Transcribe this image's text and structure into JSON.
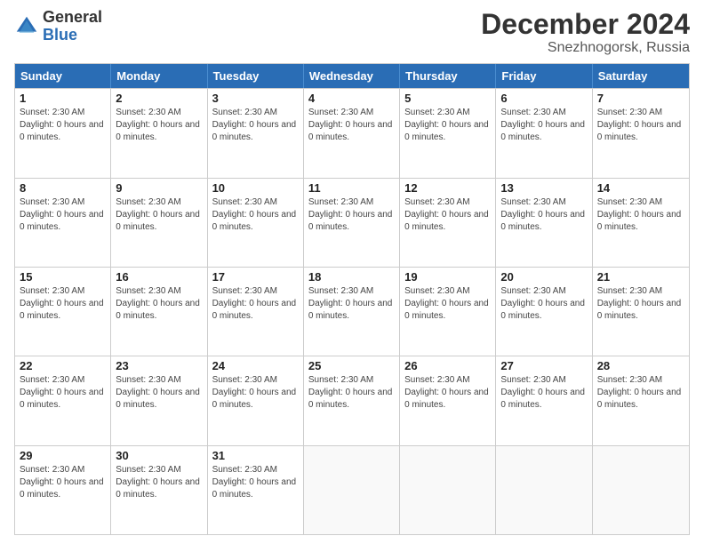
{
  "header": {
    "logo_general": "General",
    "logo_blue": "Blue",
    "title": "December 2024",
    "subtitle": "Snezhnogorsk, Russia"
  },
  "calendar": {
    "days_of_week": [
      "Sunday",
      "Monday",
      "Tuesday",
      "Wednesday",
      "Thursday",
      "Friday",
      "Saturday"
    ],
    "day_info_text": "Sunset: 2:30 AM\nDaylight: 0 hours and 0 minutes.",
    "weeks": [
      [
        {
          "day": "1",
          "empty": false
        },
        {
          "day": "2",
          "empty": false
        },
        {
          "day": "3",
          "empty": false
        },
        {
          "day": "4",
          "empty": false
        },
        {
          "day": "5",
          "empty": false
        },
        {
          "day": "6",
          "empty": false
        },
        {
          "day": "7",
          "empty": false
        }
      ],
      [
        {
          "day": "8",
          "empty": false
        },
        {
          "day": "9",
          "empty": false
        },
        {
          "day": "10",
          "empty": false
        },
        {
          "day": "11",
          "empty": false
        },
        {
          "day": "12",
          "empty": false
        },
        {
          "day": "13",
          "empty": false
        },
        {
          "day": "14",
          "empty": false
        }
      ],
      [
        {
          "day": "15",
          "empty": false
        },
        {
          "day": "16",
          "empty": false
        },
        {
          "day": "17",
          "empty": false
        },
        {
          "day": "18",
          "empty": false
        },
        {
          "day": "19",
          "empty": false
        },
        {
          "day": "20",
          "empty": false
        },
        {
          "day": "21",
          "empty": false
        }
      ],
      [
        {
          "day": "22",
          "empty": false
        },
        {
          "day": "23",
          "empty": false
        },
        {
          "day": "24",
          "empty": false
        },
        {
          "day": "25",
          "empty": false
        },
        {
          "day": "26",
          "empty": false
        },
        {
          "day": "27",
          "empty": false
        },
        {
          "day": "28",
          "empty": false
        }
      ],
      [
        {
          "day": "29",
          "empty": false
        },
        {
          "day": "30",
          "empty": false
        },
        {
          "day": "31",
          "empty": false
        },
        {
          "day": "",
          "empty": true
        },
        {
          "day": "",
          "empty": true
        },
        {
          "day": "",
          "empty": true
        },
        {
          "day": "",
          "empty": true
        }
      ]
    ],
    "sunset_label": "Sunset: 2:30 AM",
    "daylight_label": "Daylight: 0 hours and 0 minutes."
  }
}
